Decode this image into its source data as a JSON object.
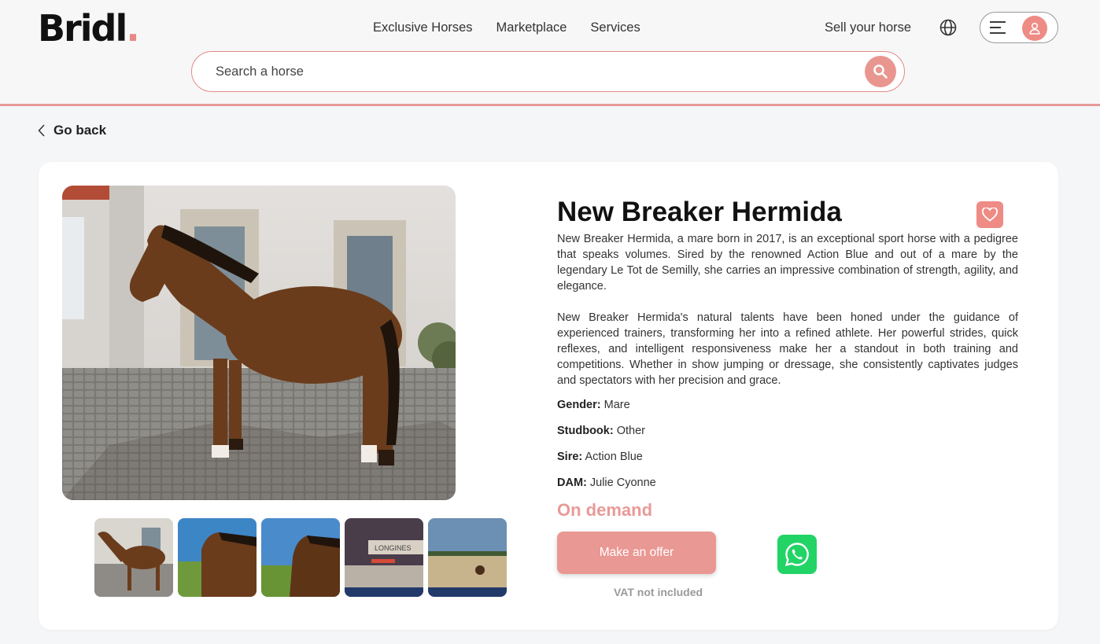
{
  "brand": {
    "name": "Bridl",
    "dot": ".",
    "accent": "#e89a98"
  },
  "nav": {
    "items": [
      "Exclusive Horses",
      "Marketplace",
      "Services"
    ],
    "sell": "Sell your horse"
  },
  "icons": {
    "globe": "globe-icon",
    "menu": "hamburger-icon",
    "user": "user-icon",
    "search": "search-icon",
    "back": "chevron-left-icon",
    "favorite": "heart-icon",
    "whatsapp": "whatsapp-icon"
  },
  "search": {
    "placeholder": "Search a horse"
  },
  "back": {
    "label": "Go back"
  },
  "horse": {
    "name": "New Breaker Hermida",
    "description": [
      "New Breaker Hermida, a mare born in 2017, is an exceptional sport horse with a pedigree that speaks volumes. Sired by the renowned Action Blue and out of a mare by the legendary Le Tot de Semilly, she carries an impressive combination of strength, agility, and elegance.",
      "New Breaker Hermida's natural talents have been honed under the guidance of experienced trainers, transforming her into a refined athlete. Her powerful strides, quick reflexes, and intelligent responsiveness make her a standout in both training and competitions. Whether in show jumping or dressage, she consistently captivates judges and spectators with her precision and grace."
    ],
    "attributes": [
      {
        "label": "Gender:",
        "value": "Mare"
      },
      {
        "label": "Studbook:",
        "value": "Other"
      },
      {
        "label": "Sire:",
        "value": "Action Blue"
      },
      {
        "label": "DAM:",
        "value": "Julie Cyonne"
      }
    ],
    "price": "On demand",
    "offer_label": "Make an offer",
    "vat_note": "VAT not included"
  },
  "gallery": {
    "thumbnail_count": 5,
    "thumb_scene": "thumbnail-3-text",
    "thumb_scene_text": "LONGINES"
  }
}
